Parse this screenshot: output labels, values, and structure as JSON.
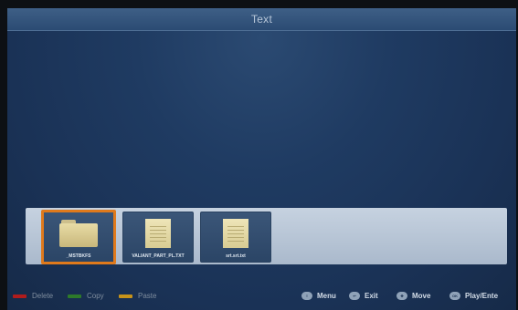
{
  "header": {
    "title": "Text"
  },
  "files": [
    {
      "name": "_MSTBKFS",
      "type": "folder",
      "selected": true
    },
    {
      "name": "VALIANT_PART_PL.TXT",
      "type": "document",
      "selected": false
    },
    {
      "name": "srt.srt.txt",
      "type": "document",
      "selected": false
    }
  ],
  "footer": {
    "color_keys": [
      {
        "label": "Delete",
        "color": "#b01c1c"
      },
      {
        "label": "Copy",
        "color": "#2d7a2a"
      },
      {
        "label": "Paste",
        "color": "#c7931a"
      }
    ],
    "nav": [
      {
        "label": "Menu",
        "icon": "menu-icon"
      },
      {
        "label": "Exit",
        "icon": "exit-icon"
      },
      {
        "label": "Move",
        "icon": "move-icon"
      },
      {
        "label": "Play/Ente",
        "icon": "ok-icon"
      }
    ]
  },
  "colors": {
    "selection": "#e07a1c",
    "background": "#1f3b62"
  }
}
